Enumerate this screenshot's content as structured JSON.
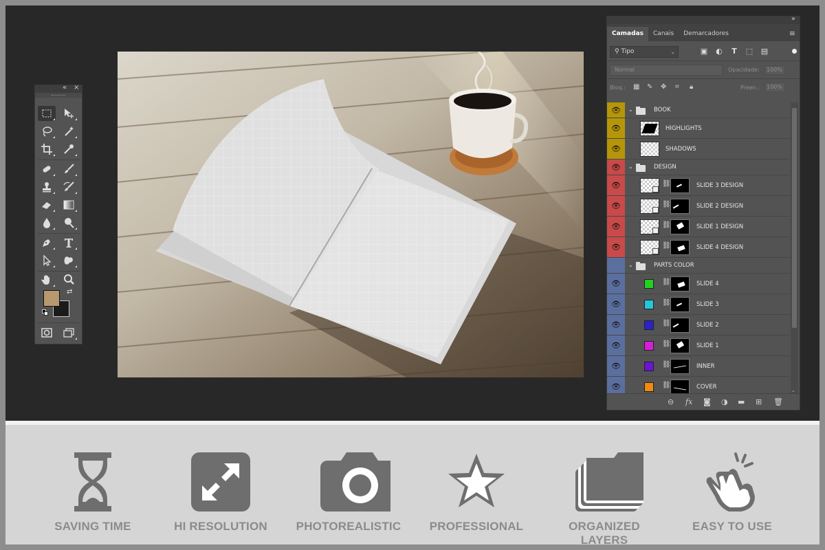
{
  "layers_panel": {
    "tabs": [
      {
        "label": "Camadas",
        "active": true
      },
      {
        "label": "Canais",
        "active": false
      },
      {
        "label": "Demarcadores",
        "active": false
      }
    ],
    "kind_filter": "Tipo",
    "blend_mode": "Normal",
    "opacity_label": "Opacidade:",
    "opacity_value": "100%",
    "lock_label": "Bloq.:",
    "fill_label": "Preen.:",
    "fill_value": "100%",
    "layers": [
      {
        "name": "BOOK",
        "type": "group",
        "visible": true,
        "tag_color": "#b5960a"
      },
      {
        "name": "HIGHLIGHTS",
        "type": "layer",
        "visible": true,
        "tag_color": "#b5960a"
      },
      {
        "name": "SHADOWS",
        "type": "layer",
        "visible": true,
        "tag_color": "#b5960a"
      },
      {
        "name": "DESIGN",
        "type": "group",
        "visible": true,
        "tag_color": "#c84a4a"
      },
      {
        "name": "SLIDE 3 DESIGN",
        "type": "smart",
        "visible": true,
        "tag_color": "#c84a4a"
      },
      {
        "name": "SLIDE 2 DESIGN",
        "type": "smart",
        "visible": true,
        "tag_color": "#c84a4a"
      },
      {
        "name": "SLIDE 1 DESIGN",
        "type": "smart",
        "visible": true,
        "tag_color": "#c84a4a"
      },
      {
        "name": "SLIDE 4 DESIGN",
        "type": "smart",
        "visible": true,
        "tag_color": "#c84a4a"
      },
      {
        "name": "PARTS COLOR",
        "type": "group",
        "visible": false,
        "tag_color": "#5b6f9f"
      },
      {
        "name": "SLIDE 4",
        "type": "color",
        "visible": true,
        "tag_color": "#5b6f9f",
        "fill": "#22d122"
      },
      {
        "name": "SLIDE 3",
        "type": "color",
        "visible": true,
        "tag_color": "#5b6f9f",
        "fill": "#22c8d8"
      },
      {
        "name": "SLIDE 2",
        "type": "color",
        "visible": true,
        "tag_color": "#5b6f9f",
        "fill": "#2c22c8"
      },
      {
        "name": "SLIDE 1",
        "type": "color",
        "visible": true,
        "tag_color": "#5b6f9f",
        "fill": "#d61ed6"
      },
      {
        "name": "INNER",
        "type": "color",
        "visible": true,
        "tag_color": "#5b6f9f",
        "fill": "#6a14d6"
      },
      {
        "name": "COVER",
        "type": "color",
        "visible": true,
        "tag_color": "#5b6f9f",
        "fill": "#f08a10"
      }
    ]
  },
  "tools_panel": {
    "foreground_color": "#b8986e",
    "background_color": "#1b1b1b",
    "tools": [
      "marquee-tool",
      "move-tool",
      "lasso-tool",
      "magic-wand-tool",
      "crop-tool",
      "eyedropper-tool",
      "healing-tool",
      "brush-tool",
      "stamp-tool",
      "history-brush-tool",
      "eraser-tool",
      "gradient-tool",
      "blur-tool",
      "dodge-tool",
      "pen-tool",
      "type-tool",
      "path-selection-tool",
      "shape-tool",
      "hand-tool",
      "zoom-tool"
    ]
  },
  "features": [
    {
      "label": "SAVING TIME",
      "icon": "hourglass-icon"
    },
    {
      "label": "HI RESOLUTION",
      "icon": "expand-arrows-icon"
    },
    {
      "label": "PHOTOREALISTIC",
      "icon": "camera-icon"
    },
    {
      "label": "PROFESSIONAL",
      "icon": "star-icon"
    },
    {
      "label": "ORGANIZED LAYERS",
      "icon": "layers-folder-icon"
    },
    {
      "label": "EASY TO USE",
      "icon": "pointing-hand-icon"
    }
  ],
  "colors": {
    "workspace": "#282828",
    "panel": "#535353",
    "feature_label": "#8b8b8b",
    "feature_bar": "#d5d5d5"
  }
}
